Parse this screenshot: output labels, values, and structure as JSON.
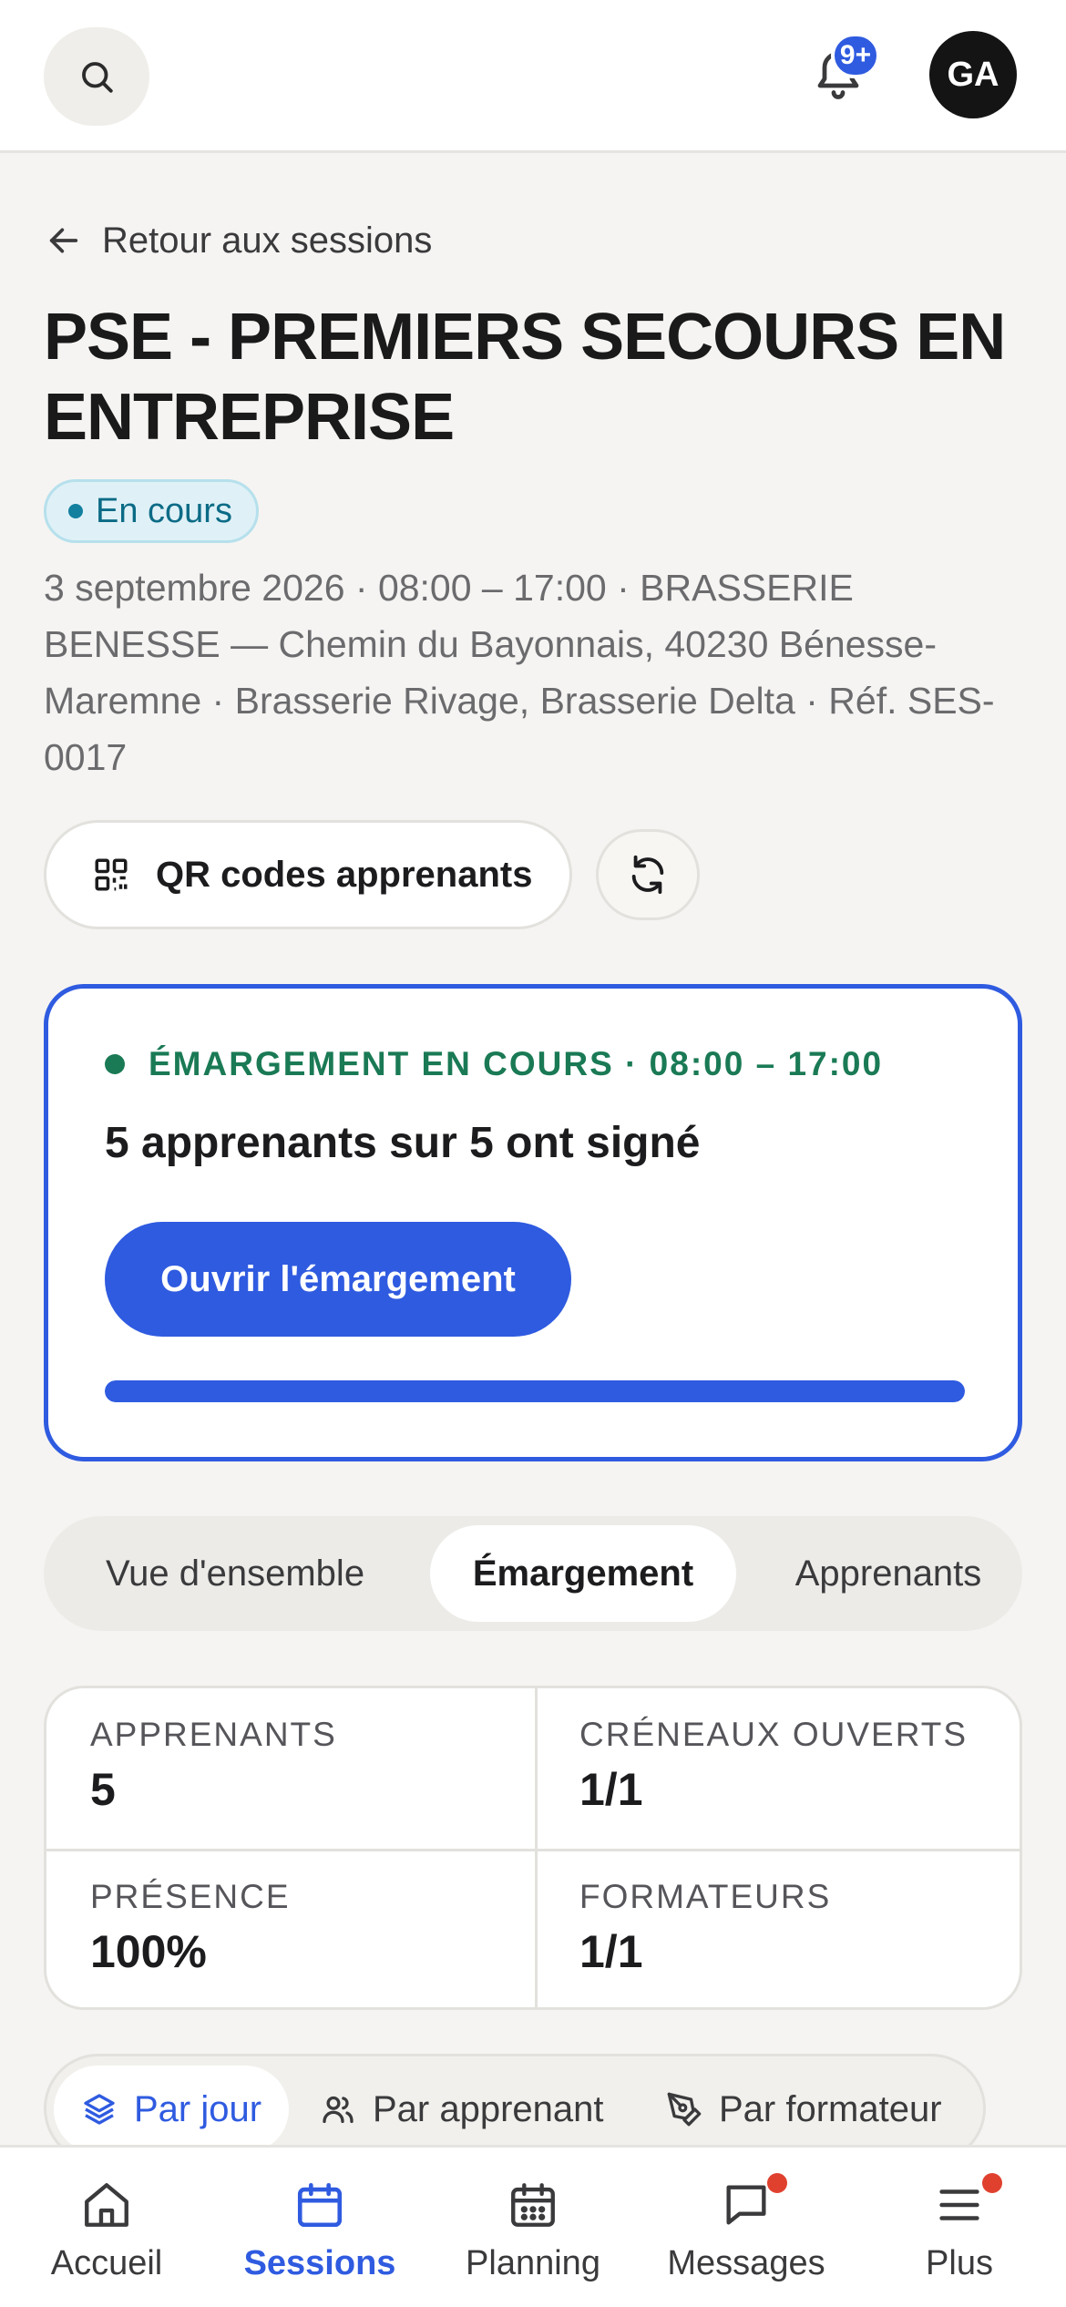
{
  "header": {
    "search_icon": "search-icon",
    "bell_icon": "bell-icon",
    "notification_badge": "9+",
    "avatar_initials": "GA"
  },
  "back_link": {
    "label": "Retour aux sessions",
    "icon": "arrow-left-icon"
  },
  "session": {
    "title": "PSE - PREMIERS SECOURS EN ENTREPRISE",
    "status": "En cours",
    "meta": "3 septembre 2026 · 08:00 – 17:00 · BRASSERIE BENESSE — Chemin du Bayonnais, 40230 Bénesse-Maremne · Brasserie Rivage, Brasserie Delta · Réf. SES-0017"
  },
  "actions": {
    "qr_label": "QR codes apprenants",
    "qr_icon": "qr-code-icon",
    "refresh_icon": "refresh-icon"
  },
  "signin": {
    "status_line": "ÉMARGEMENT EN COURS · 08:00 – 17:00",
    "count_text": "5 apprenants sur 5 ont signé",
    "open_button": "Ouvrir l'émargement",
    "progress": 1.0
  },
  "tabs": [
    {
      "label": "Vue d'ensemble",
      "active": false
    },
    {
      "label": "Émargement",
      "active": true
    },
    {
      "label": "Apprenants",
      "active": false
    }
  ],
  "stats": [
    {
      "label": "APPRENANTS",
      "value": "5"
    },
    {
      "label": "CRÉNEAUX OUVERTS",
      "value": "1/1"
    },
    {
      "label": "PRÉSENCE",
      "value": "100%"
    },
    {
      "label": "FORMATEURS",
      "value": "1/1"
    }
  ],
  "view_switch": [
    {
      "label": "Par jour",
      "icon": "layers-icon",
      "active": true
    },
    {
      "label": "Par apprenant",
      "icon": "users-icon",
      "active": false
    },
    {
      "label": "Par formateur",
      "icon": "pen-tool-icon",
      "active": false
    }
  ],
  "bottom_nav": [
    {
      "label": "Accueil",
      "icon": "home-icon",
      "active": false,
      "dot": false
    },
    {
      "label": "Sessions",
      "icon": "calendar-icon",
      "active": true,
      "dot": false
    },
    {
      "label": "Planning",
      "icon": "calendar-grid-icon",
      "active": false,
      "dot": false
    },
    {
      "label": "Messages",
      "icon": "message-icon",
      "active": false,
      "dot": true
    },
    {
      "label": "Plus",
      "icon": "menu-icon",
      "active": false,
      "dot": true
    }
  ],
  "colors": {
    "accent": "#2f5be0",
    "success": "#1a7a55",
    "status_teal": "#0c6b86",
    "alert_dot": "#e0412f",
    "background": "#f5f4f2"
  }
}
